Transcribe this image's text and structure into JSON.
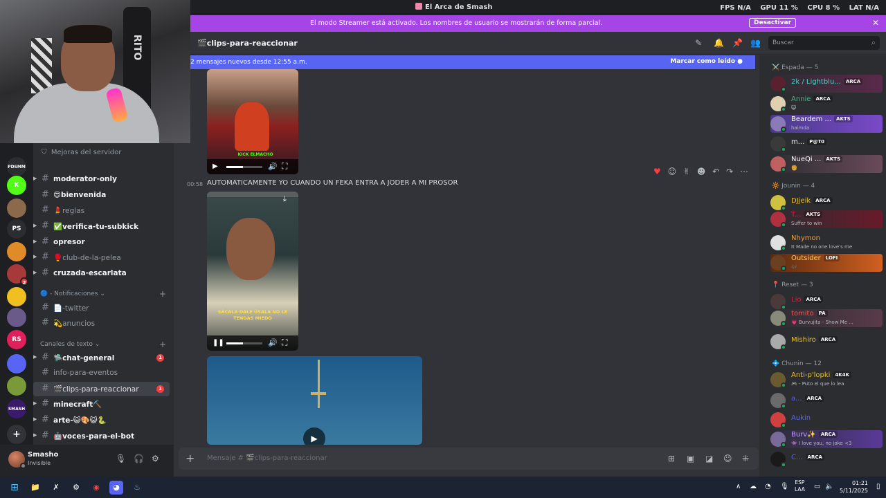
{
  "window": {
    "title": "El Arca de Smash",
    "stats": [
      "FPS  N/A",
      "GPU  11 %",
      "CPU  8 %",
      "LAT  N/A"
    ]
  },
  "streamer_banner": {
    "text": "El modo Streamer está activado. Los nombres de usuario se mostrarán de forma parcial.",
    "button": "Desactivar"
  },
  "header": {
    "channel": "clips-para-reaccionar",
    "search_placeholder": "Buscar"
  },
  "new_messages": {
    "text": "2 mensajes nuevos desde 12:55 a.m.",
    "mark_read": "Marcar como leído"
  },
  "guilds": [
    {
      "label": "PDSMM",
      "color": "#2b2d31"
    },
    {
      "label": "K",
      "color": "#53fc18"
    },
    {
      "label": "",
      "color": "#8a6a4a"
    },
    {
      "label": "PS",
      "color": "#2b2d31"
    },
    {
      "label": "",
      "color": "#e08b2a"
    },
    {
      "label": "2",
      "color": "#a63a3a"
    },
    {
      "label": "",
      "color": "#f0c020"
    },
    {
      "label": "",
      "color": "#6a5a8a"
    },
    {
      "label": "RS",
      "color": "#e0205a"
    },
    {
      "label": "",
      "color": "#5865f2"
    },
    {
      "label": "",
      "color": "#7a9a3a"
    },
    {
      "label": "SMASH",
      "color": "#3a1a6a"
    }
  ],
  "sidebar": {
    "boosts": "Mejoras del servidor",
    "channels": [
      {
        "name": "moderator-only",
        "style": "bright",
        "arrow": true
      },
      {
        "name": "😍bienvenida",
        "style": "bright",
        "arrow": false
      },
      {
        "name": "💄reglas",
        "style": "dim",
        "arrow": false
      },
      {
        "name": "✅verifica-tu-subkick",
        "style": "bright",
        "arrow": true
      },
      {
        "name": "opresor",
        "style": "bright",
        "arrow": true
      },
      {
        "name": "🥊club-de-la-pelea",
        "style": "dim",
        "arrow": true
      },
      {
        "name": "cruzada-escarlata",
        "style": "bright",
        "arrow": true
      }
    ],
    "cat_notifications": "🔵 - Notificaciones",
    "notif_channels": [
      {
        "name": "📄-twitter",
        "style": "dim"
      },
      {
        "name": "💫anuncios",
        "style": "dim"
      }
    ],
    "cat_text": "Canales de texto",
    "text_channels": [
      {
        "name": "🛸chat-general",
        "style": "bright",
        "arrow": true,
        "unread": "1"
      },
      {
        "name": "info-para-eventos",
        "style": "dim",
        "arrow": false
      },
      {
        "name": "🎬clips-para-reaccionar",
        "style": "sel",
        "arrow": false,
        "unread": "1"
      },
      {
        "name": "minecraft⛏️",
        "style": "bright",
        "arrow": true
      },
      {
        "name": "arte-😺🎨😺🐍",
        "style": "bright",
        "arrow": true
      },
      {
        "name": "🤖voces-para-el-bot",
        "style": "bright",
        "arrow": true
      }
    ]
  },
  "user": {
    "name": "Smasho",
    "status": "Invisible"
  },
  "chat": {
    "message_time": "00:58",
    "message_text": "AUTOMATICAMENTE YO CUANDO UN FEKA ENTRA A JODER A MI PROSOR",
    "video1_caption": "KICK ELMACHO",
    "video2_caption": "SÁCALA DALE ÚSALA NO LE TENGAS MIEDO"
  },
  "composer": {
    "placeholder": "Mensaje # 🎬clips-para-reaccionar"
  },
  "members": {
    "groups": [
      {
        "title": "⚔️ Espada — 5",
        "items": [
          {
            "name": "2k / Lightblu...",
            "color": "#4fd1c5",
            "tag": "ARCA",
            "activity": "",
            "bg": "linear-gradient(90deg,transparent,#5a2a4a)",
            "avatar": "#5a2030"
          },
          {
            "name": "Annie",
            "color": "#43b581",
            "tag": "ARCA",
            "activity": "😺",
            "bg": "",
            "avatar": "#e0d0b0"
          },
          {
            "name": "Beardem ...",
            "color": "#ffffff",
            "tag": "AKTS",
            "activity": "haimda",
            "bg": "linear-gradient(90deg,#4a3a8a,#7a4ac8)",
            "avatar": "#8a7ab8"
          },
          {
            "name": "m...",
            "color": "#f2f3f5",
            "tag": "P@T0",
            "activity": "",
            "bg": "",
            "avatar": "#3a3a3a"
          },
          {
            "name": "NueQi ...",
            "color": "#ffffff",
            "tag": "AKTS",
            "activity": "🍔",
            "bg": "linear-gradient(90deg,transparent,#6a4a5a)",
            "avatar": "#c06060"
          }
        ]
      },
      {
        "title": "🔆 Jounin — 4",
        "items": [
          {
            "name": "DJjeik",
            "color": "#f0c020",
            "tag": "ARCA",
            "activity": "",
            "bg": "",
            "avatar": "#d0c040"
          },
          {
            "name": "T...",
            "color": "#e02040",
            "tag": "AKTS",
            "activity": "Suffer to win",
            "bg": "linear-gradient(90deg,transparent,#6a1a2a)",
            "avatar": "#b03040"
          },
          {
            "name": "Nhymon",
            "color": "#f0a040",
            "tag": "",
            "activity": "It Made no one love's me",
            "bg": "",
            "avatar": "#e0e0e0"
          },
          {
            "name": "Outsider",
            "color": "#ffd060",
            "tag": "LOFI",
            "activity": "🎶",
            "bg": "linear-gradient(90deg,#5a2a10,#d06020)",
            "avatar": "#6a4020"
          }
        ]
      },
      {
        "title": "📍 Reset — 3",
        "items": [
          {
            "name": "Lio",
            "color": "#e02040",
            "tag": "ARCA",
            "activity": "",
            "bg": "",
            "avatar": "#4a3a3a"
          },
          {
            "name": "tomito",
            "color": "#ff5050",
            "tag": "PA",
            "activity": "💗 Burvujita - Show Me ...",
            "bg": "linear-gradient(90deg,transparent,#5a3a4a)",
            "avatar": "#8a8a7a"
          },
          {
            "name": "Mishiro",
            "color": "#f0c020",
            "tag": "ARCA",
            "activity": "",
            "bg": "",
            "avatar": "#aaaaaa"
          }
        ]
      },
      {
        "title": "💠 Chunin — 12",
        "items": [
          {
            "name": "Anti-p'lopki",
            "color": "#f0c020",
            "tag": "4K4K",
            "activity": "🎮 - Puto el que lo lea",
            "bg": "",
            "avatar": "#6a5a30"
          },
          {
            "name": "a...",
            "color": "#5865f2",
            "tag": "ARCA",
            "activity": "",
            "bg": "",
            "avatar": "#6a6a6a"
          },
          {
            "name": "Aukin",
            "color": "#5865f2",
            "tag": "",
            "activity": "",
            "bg": "",
            "avatar": "#d04040"
          },
          {
            "name": "Burv✨",
            "color": "#c0a0ff",
            "tag": "ARCA",
            "activity": "👾 I love you, no joke <3",
            "bg": "linear-gradient(90deg,transparent,#5a3a9a)",
            "avatar": "#7a6a9a"
          },
          {
            "name": "C...",
            "color": "#5865f2",
            "tag": "ARCA",
            "activity": "",
            "bg": "",
            "avatar": "#1a1a1a"
          }
        ]
      }
    ]
  },
  "taskbar": {
    "lang_top": "ESP",
    "lang_bottom": "LAA",
    "time": "01:21",
    "date": "5/11/2025"
  }
}
